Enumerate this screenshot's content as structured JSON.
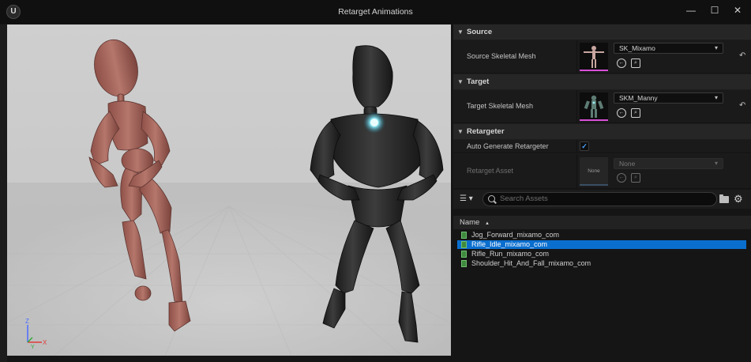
{
  "window": {
    "title": "Retarget Animations",
    "controls": {
      "minimize": "—",
      "maximize": "☐",
      "close": "✕"
    },
    "logo": "U"
  },
  "viewport": {
    "gizmo": {
      "z": "Z",
      "x": "X",
      "y": "Y"
    }
  },
  "details": {
    "source": {
      "header": "Source",
      "label": "Source Skeletal Mesh",
      "value": "SK_Mixamo"
    },
    "target": {
      "header": "Target",
      "label": "Target Skeletal Mesh",
      "value": "SKM_Manny"
    },
    "retargeter": {
      "header": "Retargeter",
      "auto_label": "Auto Generate Retargeter",
      "auto_checked": true,
      "asset_label": "Retarget Asset",
      "asset_value": "None",
      "asset_thumb": "None"
    }
  },
  "assets": {
    "search_placeholder": "Search Assets",
    "column_name": "Name",
    "sort_glyph": "▲",
    "items": [
      {
        "name": "Jog_Forward_mixamo_com",
        "selected": false
      },
      {
        "name": "Rifle_Idle_mixamo_com",
        "selected": true
      },
      {
        "name": "Rifle_Run_mixamo_com",
        "selected": false
      },
      {
        "name": "Shoulder_Hit_And_Fall_mixamo_com",
        "selected": false
      }
    ]
  },
  "colors": {
    "accent": "#0a6ecf",
    "mannequin_source": "#a96a60",
    "mannequin_target": "#2b2b2b",
    "chest_glow": "#7fe9ff"
  }
}
